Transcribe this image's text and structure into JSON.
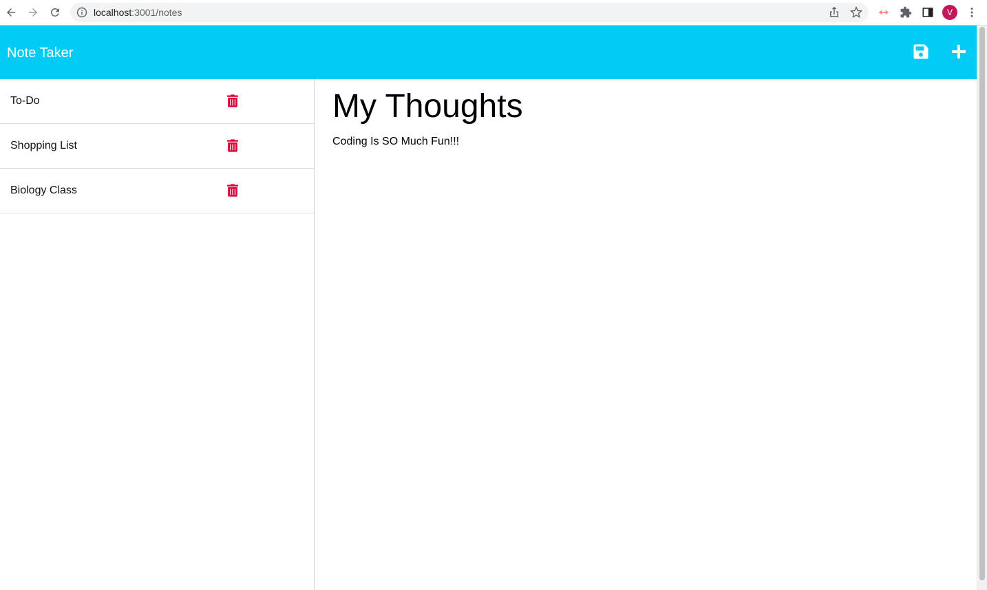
{
  "browser": {
    "url_host": "localhost",
    "url_path": ":3001/notes",
    "profile_initial": "V"
  },
  "app": {
    "brand": "Note Taker",
    "accent_color": "#00ccf5",
    "delete_color": "#e0003a",
    "icons": {
      "save": "save-icon",
      "add": "plus-icon",
      "delete": "trash-icon"
    }
  },
  "notes": [
    {
      "title": "To-Do"
    },
    {
      "title": "Shopping List"
    },
    {
      "title": "Biology Class"
    }
  ],
  "active_note": {
    "title": "My Thoughts",
    "text": "Coding Is SO Much Fun!!!"
  }
}
